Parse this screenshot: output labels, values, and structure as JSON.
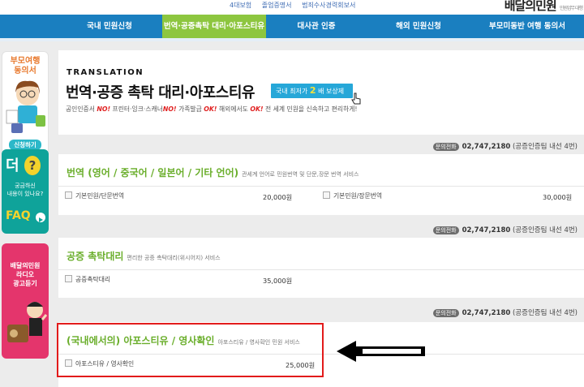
{
  "toplinks": [
    "4대보험",
    "졸업증명서",
    "범죄수사경력회보서"
  ],
  "logo": {
    "text": "배달의민원",
    "sub": "민원업무 대행"
  },
  "nav": [
    {
      "label": "국내 민원신청"
    },
    {
      "label": "번역·공증촉탁 대리·아포스티유"
    },
    {
      "label": "대사관 인증"
    },
    {
      "label": "해외 민원신청"
    },
    {
      "label": "부모미동반 여행 동의서"
    }
  ],
  "sidebar": {
    "banner1": {
      "title": "부모여행\n동의서",
      "button": "신청하기"
    },
    "banner2": {
      "big": "더",
      "q": "?",
      "small": "궁금하신\n내용이 있나요?",
      "faq": "FAQ"
    },
    "banner3": {
      "text": "배달의민원\n라디오\n광고듣기"
    }
  },
  "hero": {
    "en": "TRANSLATION",
    "title": "번역·공증 촉탁 대리·아포스티유",
    "promo_prefix": "국내 최저가",
    "promo_num": "2",
    "promo_suffix": "배 보상제",
    "desc_parts": [
      {
        "t": "공인인증서 ",
        "red": false
      },
      {
        "t": "NO!",
        "red": true
      },
      {
        "t": " 프린터·잉크·스캐너",
        "red": false
      },
      {
        "t": "NO!",
        "red": true
      },
      {
        "t": " 가족발급 ",
        "red": false
      },
      {
        "t": "OK!",
        "red": true
      },
      {
        "t": " 해외에서도 ",
        "red": false
      },
      {
        "t": "OK!",
        "red": true
      },
      {
        "t": " 전 세계 민원을 신속하고 편리하게!",
        "red": false
      }
    ]
  },
  "contact": {
    "badge": "문의전화",
    "number": "02,747,2180",
    "note": "(공증인증팀 내선 4번)"
  },
  "sections": [
    {
      "title": "번역 (영어 / 중국어 / 일본어 / 기타 언어)",
      "subtitle": "관세계 언어로 민원번역 및 단문,장문 번역 서비스",
      "items": [
        {
          "label": "기본민원/단문번역",
          "price": "20,000원"
        },
        {
          "label": "기본민원/장문번역",
          "price": "30,000원"
        }
      ]
    },
    {
      "title": "공증 촉탁대리",
      "subtitle": "편리한 공증 촉탁대리(위시어지) 서비스",
      "items": [
        {
          "label": "공증촉탁대리",
          "price": "35,000원"
        }
      ]
    },
    {
      "title": "(국내에서의) 아포스티유 / 영사확인",
      "subtitle": "아포스티유 / 영사확인 민원 서비스",
      "items": [
        {
          "label": "아포스티유 / 영사확인",
          "price": "25,000원"
        }
      ]
    }
  ],
  "colors": {
    "nav": "#1a7fc0",
    "active": "#8dc63f",
    "title_green": "#6aae2b",
    "highlight": "#e21b1b"
  }
}
